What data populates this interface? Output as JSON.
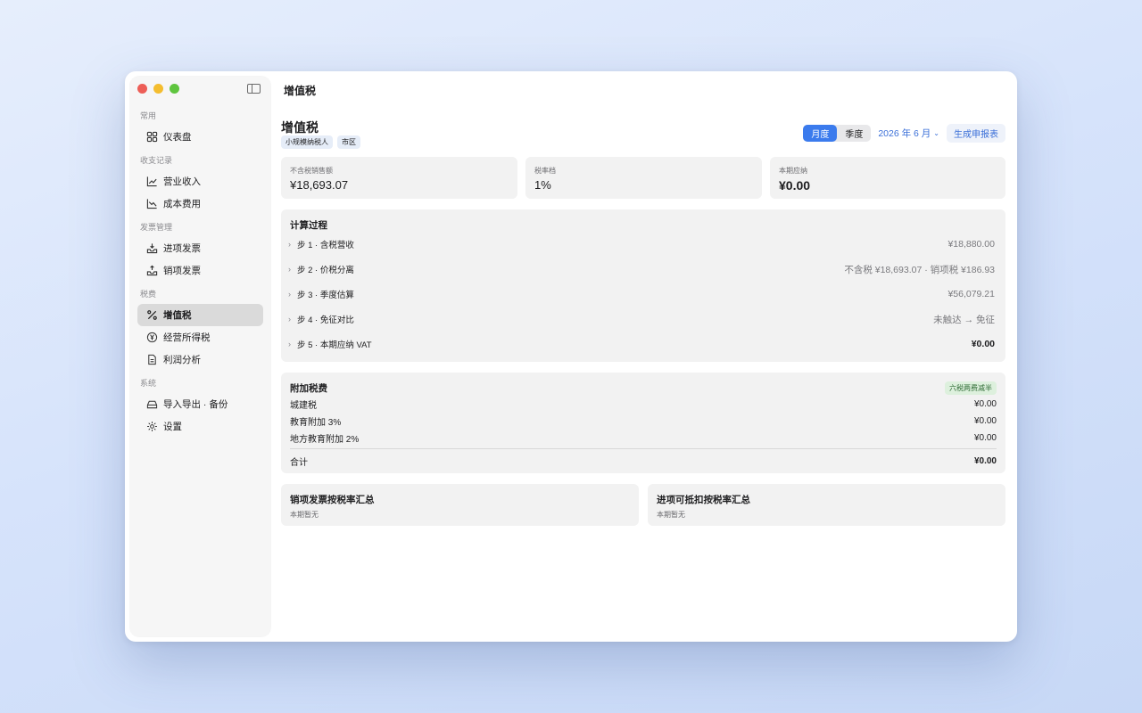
{
  "window": {
    "title": "增值税"
  },
  "sidebar": {
    "sections": [
      {
        "label": "常用",
        "items": [
          {
            "label": "仪表盘",
            "icon": "grid-icon"
          }
        ]
      },
      {
        "label": "收支记录",
        "items": [
          {
            "label": "营业收入",
            "icon": "chart-up-icon"
          },
          {
            "label": "成本费用",
            "icon": "chart-down-icon"
          }
        ]
      },
      {
        "label": "发票管理",
        "items": [
          {
            "label": "进项发票",
            "icon": "tray-in-icon"
          },
          {
            "label": "销项发票",
            "icon": "tray-out-icon"
          }
        ]
      },
      {
        "label": "税费",
        "items": [
          {
            "label": "增值税",
            "icon": "percent-icon",
            "active": true
          },
          {
            "label": "经营所得税",
            "icon": "yen-circle-icon"
          },
          {
            "label": "利润分析",
            "icon": "document-icon"
          }
        ]
      },
      {
        "label": "系统",
        "items": [
          {
            "label": "导入导出 · 备份",
            "icon": "drive-icon"
          },
          {
            "label": "设置",
            "icon": "gear-icon"
          }
        ]
      }
    ]
  },
  "header": {
    "title": "增值税",
    "tags": [
      "小规模纳税人",
      "市区"
    ],
    "segment": {
      "options": [
        "月度",
        "季度"
      ],
      "selected": "月度"
    },
    "period": "2026 年 6 月",
    "generate_label": "生成申报表"
  },
  "kpis": [
    {
      "label": "不含税销售额",
      "value": "¥18,693.07",
      "bold": false
    },
    {
      "label": "税率档",
      "value": "1%",
      "bold": false
    },
    {
      "label": "本期应纳",
      "value": "¥0.00",
      "bold": true
    }
  ],
  "calc": {
    "title": "计算过程",
    "steps": [
      {
        "label": "步 1 · 含税营收",
        "value": "¥18,880.00",
        "bold": false
      },
      {
        "label": "步 2 · 价税分离",
        "value": "不含税 ¥18,693.07 · 销项税 ¥186.93",
        "bold": false
      },
      {
        "label": "步 3 · 季度估算",
        "value": "¥56,079.21",
        "bold": false
      },
      {
        "label": "步 4 · 免征对比",
        "value": "未触达 → 免征",
        "bold": false
      },
      {
        "label": "步 5 · 本期应纳 VAT",
        "value": "¥0.00",
        "bold": true
      }
    ]
  },
  "surcharge": {
    "title": "附加税费",
    "badge": "六税两费减半",
    "rows": [
      {
        "label": "城建税",
        "value": "¥0.00"
      },
      {
        "label": "教育附加 3%",
        "value": "¥0.00"
      },
      {
        "label": "地方教育附加 2%",
        "value": "¥0.00"
      }
    ],
    "total_label": "合计",
    "total_value": "¥0.00"
  },
  "summaries": [
    {
      "title": "销项发票按税率汇总",
      "note": "本期暂无"
    },
    {
      "title": "进项可抵扣按税率汇总",
      "note": "本期暂无"
    }
  ]
}
